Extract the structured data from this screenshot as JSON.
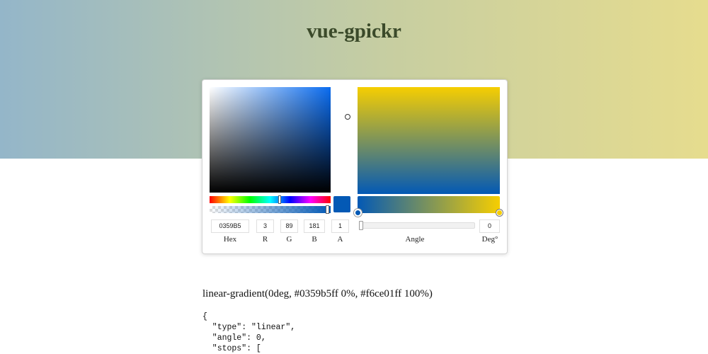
{
  "page": {
    "title": "vue-gpickr"
  },
  "colors": {
    "current": "#0359b5",
    "stop_1": "#0359b5",
    "stop_2": "#f6ce01",
    "hue_base": "#0a6cf0"
  },
  "picker": {
    "hex": "0359B5",
    "r": "3",
    "g": "89",
    "b": "181",
    "a": "1",
    "angle": "0",
    "labels": {
      "hex": "Hex",
      "r": "R",
      "g": "G",
      "b": "B",
      "a": "A",
      "angle": "Angle",
      "deg": "Deg°"
    }
  },
  "output": {
    "css": "linear-gradient(0deg, #0359b5ff 0%, #f6ce01ff 100%)",
    "json_lines": [
      "{",
      "  \"type\": \"linear\",",
      "  \"angle\": 0,",
      "  \"stops\": ["
    ]
  }
}
